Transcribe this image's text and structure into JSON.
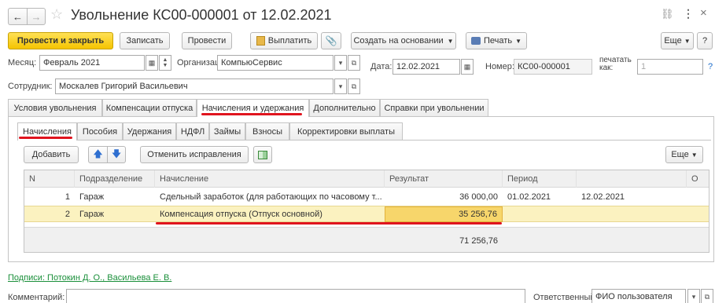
{
  "window": {
    "title": "Увольнение КС00-000001 от 12.02.2021",
    "back_icon": "arrow-left-icon",
    "forward_icon": "arrow-right-icon",
    "favorite_icon": "star-icon",
    "link_icon": "link-icon",
    "menu_icon": "more-icon",
    "close_label": "×"
  },
  "toolbar": {
    "post_and_close": "Провести и закрыть",
    "save": "Записать",
    "post": "Провести",
    "pay": "Выплатить",
    "create_based_on": "Создать на основании",
    "print": "Печать",
    "more": "Еще",
    "help": "?"
  },
  "header": {
    "month_label": "Месяц:",
    "month_value": "Февраль 2021",
    "org_label": "Организация:",
    "org_value": "КомпьюСервис",
    "date_label": "Дата:",
    "date_value": "12.02.2021",
    "number_label": "Номер:",
    "number_value": "КС00-000001",
    "print_as_label_1": "печатать",
    "print_as_label_2": "как:",
    "print_as_value": "1",
    "help": "?",
    "employee_label": "Сотрудник:",
    "employee_value": "Москалев Григорий Васильевич"
  },
  "main_tabs": [
    {
      "label": "Условия увольнения"
    },
    {
      "label": "Компенсации отпуска"
    },
    {
      "label": "Начисления и удержания"
    },
    {
      "label": "Дополнительно"
    },
    {
      "label": "Справки при увольнении"
    }
  ],
  "sub_tabs": [
    {
      "label": "Начисления"
    },
    {
      "label": "Пособия"
    },
    {
      "label": "Удержания"
    },
    {
      "label": "НДФЛ"
    },
    {
      "label": "Займы"
    },
    {
      "label": "Взносы"
    },
    {
      "label": "Корректировки выплаты"
    }
  ],
  "table_toolbar": {
    "add": "Добавить",
    "cancel_corrections": "Отменить исправления",
    "more": "Еще"
  },
  "table": {
    "columns": [
      "N",
      "Подразделение",
      "Начисление",
      "Результат",
      "Период",
      "",
      "О"
    ],
    "rows": [
      [
        "1",
        "Гараж",
        "Сдельный заработок (для работающих по часовому т...",
        "36 000,00",
        "01.02.2021",
        "12.02.2021",
        ""
      ],
      [
        "2",
        "Гараж",
        "Компенсация отпуска (Отпуск основной)",
        "35 256,76",
        "",
        "",
        ""
      ]
    ],
    "total": "71 256,76"
  },
  "footer": {
    "signatures": "Подписи: Потокин Д. О., Васильева Е. В.",
    "comment_label": "Комментарий:",
    "comment_value": "",
    "responsible_label": "Ответственный:",
    "responsible_value": "ФИО пользователя"
  },
  "colors": {
    "accent_underline": "#e0141e",
    "primary_button": "#f5c400",
    "selected_row": "#fbf2c0",
    "selected_cell": "#f7d66b",
    "link": "#1a8f3a"
  }
}
